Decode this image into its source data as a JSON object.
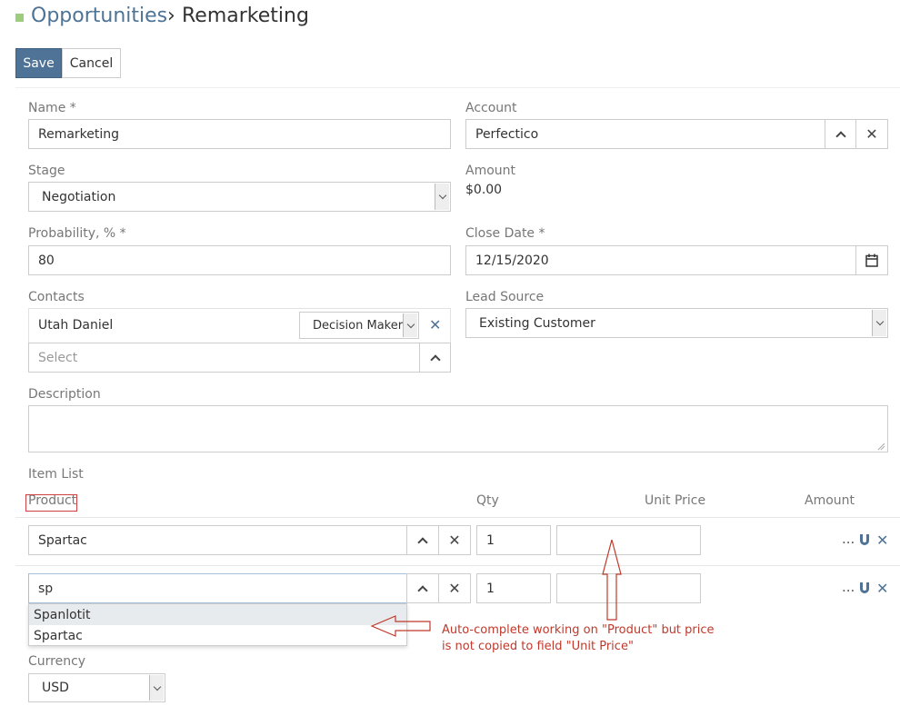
{
  "breadcrumb": {
    "parent": "Opportunities",
    "separator": "›",
    "current": "Remarketing"
  },
  "toolbar": {
    "save_label": "Save",
    "cancel_label": "Cancel"
  },
  "form": {
    "name": {
      "label": "Name *",
      "value": "Remarketing"
    },
    "account": {
      "label": "Account",
      "value": "Perfectico"
    },
    "stage": {
      "label": "Stage",
      "value": "Negotiation"
    },
    "amount": {
      "label": "Amount",
      "value": "$0.00"
    },
    "probability": {
      "label": "Probability, % *",
      "value": "80"
    },
    "close_date": {
      "label": "Close Date *",
      "value": "12/15/2020"
    },
    "contacts": {
      "label": "Contacts",
      "contact_name": "Utah Daniel",
      "role": "Decision Maker",
      "select_placeholder": "Select"
    },
    "lead_source": {
      "label": "Lead Source",
      "value": "Existing Customer"
    },
    "description": {
      "label": "Description",
      "value": ""
    },
    "item_list": {
      "label": "Item List",
      "columns": {
        "product": "Product",
        "qty": "Qty",
        "unit_price": "Unit Price",
        "amount": "Amount"
      },
      "rows": [
        {
          "product": "Spartac",
          "qty": "1",
          "unit_price": ""
        },
        {
          "product": "sp",
          "qty": "1",
          "unit_price": ""
        }
      ],
      "row_menu": "...",
      "autocomplete": [
        "Spanlotit",
        "Spartac"
      ]
    },
    "currency": {
      "label": "Currency",
      "value": "USD"
    }
  },
  "annotation": {
    "line1": "Auto-complete working on \"Product\" but price",
    "line2": "is not copied to field \"Unit Price\"",
    "color": "#c0392b"
  },
  "colors": {
    "primary": "#4e7396",
    "breadcrumb_link": "#4d7496"
  }
}
